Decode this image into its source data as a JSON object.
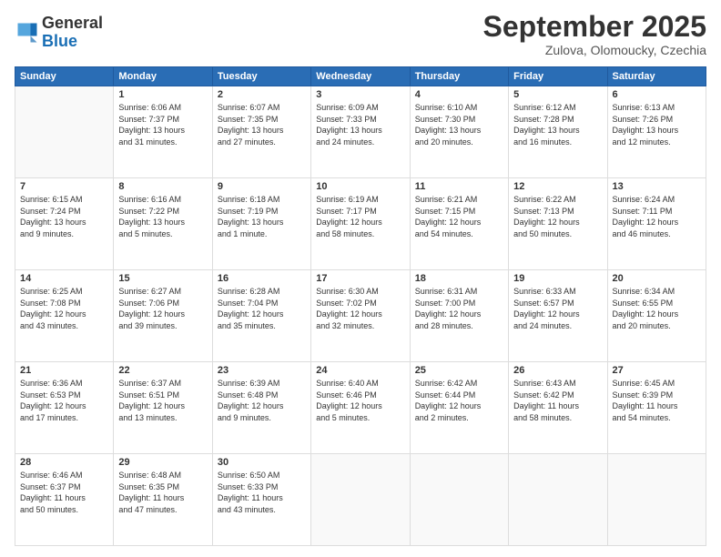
{
  "header": {
    "logo_general": "General",
    "logo_blue": "Blue",
    "month": "September 2025",
    "location": "Zulova, Olomoucky, Czechia"
  },
  "weekdays": [
    "Sunday",
    "Monday",
    "Tuesday",
    "Wednesday",
    "Thursday",
    "Friday",
    "Saturday"
  ],
  "weeks": [
    [
      {
        "day": "",
        "info": ""
      },
      {
        "day": "1",
        "info": "Sunrise: 6:06 AM\nSunset: 7:37 PM\nDaylight: 13 hours\nand 31 minutes."
      },
      {
        "day": "2",
        "info": "Sunrise: 6:07 AM\nSunset: 7:35 PM\nDaylight: 13 hours\nand 27 minutes."
      },
      {
        "day": "3",
        "info": "Sunrise: 6:09 AM\nSunset: 7:33 PM\nDaylight: 13 hours\nand 24 minutes."
      },
      {
        "day": "4",
        "info": "Sunrise: 6:10 AM\nSunset: 7:30 PM\nDaylight: 13 hours\nand 20 minutes."
      },
      {
        "day": "5",
        "info": "Sunrise: 6:12 AM\nSunset: 7:28 PM\nDaylight: 13 hours\nand 16 minutes."
      },
      {
        "day": "6",
        "info": "Sunrise: 6:13 AM\nSunset: 7:26 PM\nDaylight: 13 hours\nand 12 minutes."
      }
    ],
    [
      {
        "day": "7",
        "info": "Sunrise: 6:15 AM\nSunset: 7:24 PM\nDaylight: 13 hours\nand 9 minutes."
      },
      {
        "day": "8",
        "info": "Sunrise: 6:16 AM\nSunset: 7:22 PM\nDaylight: 13 hours\nand 5 minutes."
      },
      {
        "day": "9",
        "info": "Sunrise: 6:18 AM\nSunset: 7:19 PM\nDaylight: 13 hours\nand 1 minute."
      },
      {
        "day": "10",
        "info": "Sunrise: 6:19 AM\nSunset: 7:17 PM\nDaylight: 12 hours\nand 58 minutes."
      },
      {
        "day": "11",
        "info": "Sunrise: 6:21 AM\nSunset: 7:15 PM\nDaylight: 12 hours\nand 54 minutes."
      },
      {
        "day": "12",
        "info": "Sunrise: 6:22 AM\nSunset: 7:13 PM\nDaylight: 12 hours\nand 50 minutes."
      },
      {
        "day": "13",
        "info": "Sunrise: 6:24 AM\nSunset: 7:11 PM\nDaylight: 12 hours\nand 46 minutes."
      }
    ],
    [
      {
        "day": "14",
        "info": "Sunrise: 6:25 AM\nSunset: 7:08 PM\nDaylight: 12 hours\nand 43 minutes."
      },
      {
        "day": "15",
        "info": "Sunrise: 6:27 AM\nSunset: 7:06 PM\nDaylight: 12 hours\nand 39 minutes."
      },
      {
        "day": "16",
        "info": "Sunrise: 6:28 AM\nSunset: 7:04 PM\nDaylight: 12 hours\nand 35 minutes."
      },
      {
        "day": "17",
        "info": "Sunrise: 6:30 AM\nSunset: 7:02 PM\nDaylight: 12 hours\nand 32 minutes."
      },
      {
        "day": "18",
        "info": "Sunrise: 6:31 AM\nSunset: 7:00 PM\nDaylight: 12 hours\nand 28 minutes."
      },
      {
        "day": "19",
        "info": "Sunrise: 6:33 AM\nSunset: 6:57 PM\nDaylight: 12 hours\nand 24 minutes."
      },
      {
        "day": "20",
        "info": "Sunrise: 6:34 AM\nSunset: 6:55 PM\nDaylight: 12 hours\nand 20 minutes."
      }
    ],
    [
      {
        "day": "21",
        "info": "Sunrise: 6:36 AM\nSunset: 6:53 PM\nDaylight: 12 hours\nand 17 minutes."
      },
      {
        "day": "22",
        "info": "Sunrise: 6:37 AM\nSunset: 6:51 PM\nDaylight: 12 hours\nand 13 minutes."
      },
      {
        "day": "23",
        "info": "Sunrise: 6:39 AM\nSunset: 6:48 PM\nDaylight: 12 hours\nand 9 minutes."
      },
      {
        "day": "24",
        "info": "Sunrise: 6:40 AM\nSunset: 6:46 PM\nDaylight: 12 hours\nand 5 minutes."
      },
      {
        "day": "25",
        "info": "Sunrise: 6:42 AM\nSunset: 6:44 PM\nDaylight: 12 hours\nand 2 minutes."
      },
      {
        "day": "26",
        "info": "Sunrise: 6:43 AM\nSunset: 6:42 PM\nDaylight: 11 hours\nand 58 minutes."
      },
      {
        "day": "27",
        "info": "Sunrise: 6:45 AM\nSunset: 6:39 PM\nDaylight: 11 hours\nand 54 minutes."
      }
    ],
    [
      {
        "day": "28",
        "info": "Sunrise: 6:46 AM\nSunset: 6:37 PM\nDaylight: 11 hours\nand 50 minutes."
      },
      {
        "day": "29",
        "info": "Sunrise: 6:48 AM\nSunset: 6:35 PM\nDaylight: 11 hours\nand 47 minutes."
      },
      {
        "day": "30",
        "info": "Sunrise: 6:50 AM\nSunset: 6:33 PM\nDaylight: 11 hours\nand 43 minutes."
      },
      {
        "day": "",
        "info": ""
      },
      {
        "day": "",
        "info": ""
      },
      {
        "day": "",
        "info": ""
      },
      {
        "day": "",
        "info": ""
      }
    ]
  ]
}
